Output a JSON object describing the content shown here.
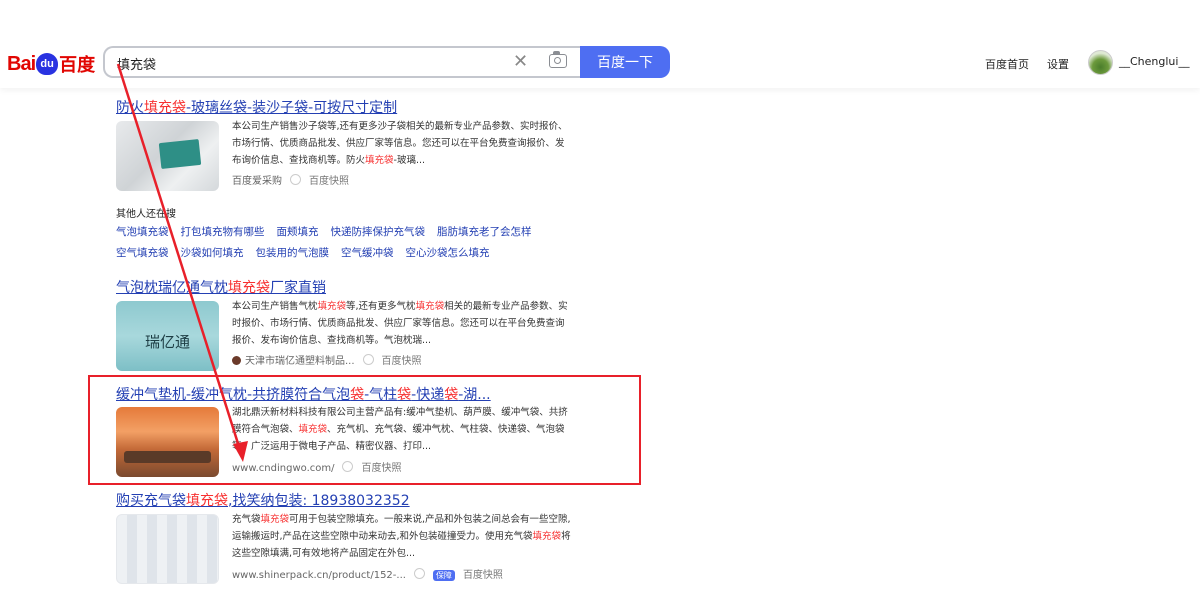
{
  "header": {
    "logo": {
      "left": "Bai",
      "paw": "du",
      "right": "百度"
    },
    "search": {
      "query": "填充袋",
      "button_label": "百度一下"
    },
    "nav": {
      "home": "百度首页",
      "settings": "设置"
    },
    "user": {
      "name": "__Chenglui__"
    }
  },
  "results": [
    {
      "title_parts": [
        {
          "t": "防火",
          "h": false
        },
        {
          "t": "填充袋",
          "h": true
        },
        {
          "t": "-玻璃丝袋-装沙子袋-可按尺寸定制",
          "h": false
        }
      ],
      "abstract_parts": [
        {
          "t": "本公司生产销售沙子袋等,还有更多沙子袋相关的最新专业产品参数、实时报价、市场行情、优质商品批发、供应厂家等信息。您还可以在平台免费查询报价、发布询价信息、查找商机等。防火",
          "h": false
        },
        {
          "t": "填充袋",
          "h": true
        },
        {
          "t": "-玻璃...",
          "h": false
        }
      ],
      "source": "百度爱采购",
      "snapshot": "百度快照"
    },
    {
      "title_parts": [
        {
          "t": "气泡枕瑞亿通气枕",
          "h": false
        },
        {
          "t": "填充袋",
          "h": true
        },
        {
          "t": "厂家直销",
          "h": false
        }
      ],
      "abstract_parts": [
        {
          "t": "本公司生产销售气枕",
          "h": false
        },
        {
          "t": "填充袋",
          "h": true
        },
        {
          "t": "等,还有更多气枕",
          "h": false
        },
        {
          "t": "填充袋",
          "h": true
        },
        {
          "t": "相关的最新专业产品参数、实时报价、市场行情、优质商品批发、供应厂家等信息。您还可以在平台免费查询报价、发布询价信息、查找商机等。气泡枕瑞...",
          "h": false
        }
      ],
      "thumb_text": "瑞亿通",
      "source": "天津市瑞亿通塑料制品...",
      "snapshot": "百度快照"
    },
    {
      "title_parts": [
        {
          "t": "缓冲气垫机-缓冲气枕-共挤膜符合气泡",
          "h": false
        },
        {
          "t": "袋",
          "h": true
        },
        {
          "t": "-气柱",
          "h": false
        },
        {
          "t": "袋",
          "h": true
        },
        {
          "t": "-快递",
          "h": false
        },
        {
          "t": "袋",
          "h": true
        },
        {
          "t": "-湖...",
          "h": false
        }
      ],
      "abstract_parts": [
        {
          "t": "湖北鼎沃新材料科技有限公司主营产品有:缓冲气垫机、葫芦膜、缓冲气袋、共挤膜符合气泡袋、",
          "h": false
        },
        {
          "t": "填充袋",
          "h": true
        },
        {
          "t": "、充气机、充气袋、缓冲气枕、气柱袋、快递袋、气泡袋等。广泛运用于微电子产品、精密仪器、打印...",
          "h": false
        }
      ],
      "source": "www.cndingwo.com/",
      "snapshot": "百度快照"
    },
    {
      "title_parts": [
        {
          "t": "购买充气袋",
          "h": false
        },
        {
          "t": "填充袋",
          "h": true
        },
        {
          "t": ",找笑纳包装: 18938032352",
          "h": false
        }
      ],
      "abstract_parts": [
        {
          "t": "充气袋",
          "h": false
        },
        {
          "t": "填充袋",
          "h": true
        },
        {
          "t": "可用于包装空隙填充。一般来说,产品和外包装之间总会有一些空隙,运输搬运时,产品在这些空隙中动来动去,和外包装碰撞受力。使用充气袋",
          "h": false
        },
        {
          "t": "填充袋",
          "h": true
        },
        {
          "t": "将这些空隙填满,可有效地将产品固定在外包...",
          "h": false
        }
      ],
      "source": "www.shinerpack.cn/product/152-...",
      "badge": "保障",
      "snapshot": "百度快照"
    }
  ],
  "also_searched": {
    "title": "其他人还在搜",
    "row1": [
      "气泡填充袋",
      "打包填充物有哪些",
      "面颊填充",
      "快递防摔保护充气袋",
      "脂肪填充老了会怎样"
    ],
    "row2": [
      "空气填充袋",
      "沙袋如何填充",
      "包装用的气泡膜",
      "空气缓冲袋",
      "空心沙袋怎么填充"
    ]
  },
  "colors": {
    "link": "#2440b3",
    "highlight": "#f73131",
    "button": "#4e6ef2",
    "annotation": "#e8202a"
  }
}
